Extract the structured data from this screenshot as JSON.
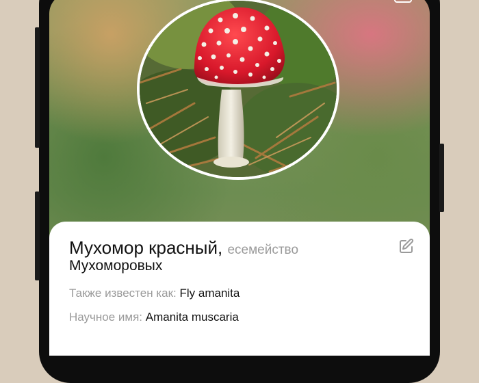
{
  "species": {
    "common_name": "Мухомор красный,",
    "family_label": "семейство",
    "family_prefix": "е",
    "family_name": "Мухоморовых"
  },
  "details": {
    "aka_label": "Также известен как:",
    "aka_value": "Fly amanita",
    "scientific_label": "Научное имя:",
    "scientific_value": "Amanita muscaria"
  },
  "icons": {
    "edit": "edit-icon",
    "top": "copy-icon"
  },
  "colors": {
    "card_bg": "#ffffff",
    "muted_text": "#9a9a9a",
    "mushroom_cap": "#d8182b"
  }
}
